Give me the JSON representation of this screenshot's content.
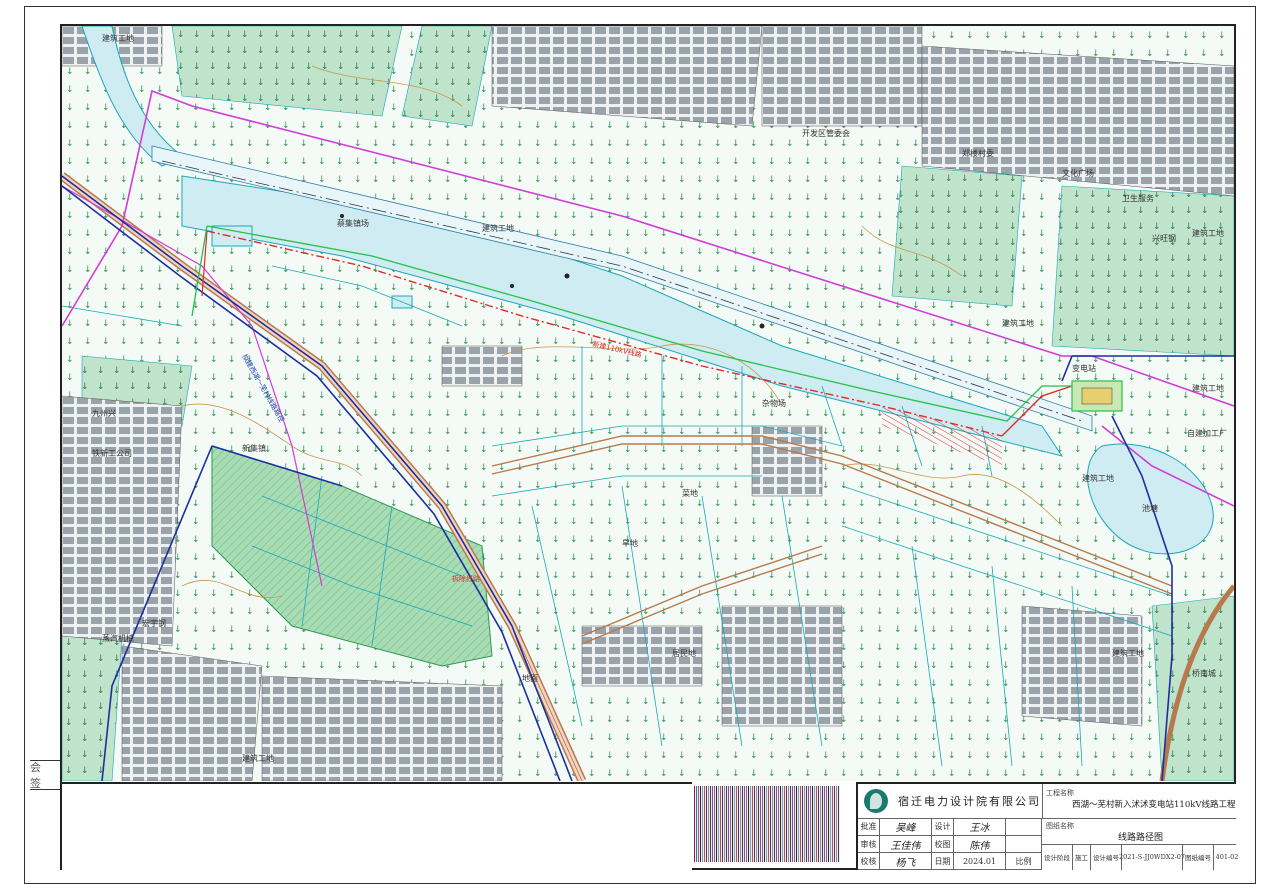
{
  "title_block": {
    "company": "宿迁电力设计院有限公司",
    "project_label": "工程名称",
    "project_name": "西湖～芜村新入沭沭变电站110kV线路工程",
    "drawing_label": "图纸名称",
    "drawing_name": "线路路径图",
    "roles": [
      "批准",
      "审核",
      "校核"
    ],
    "role_sigs": [
      "吴峰",
      "王佳伟",
      "杨飞"
    ],
    "roles_right": [
      "设计",
      "校图",
      "日期"
    ],
    "role_sigs_right": [
      "王冰",
      "陈伟",
      ""
    ],
    "date_value": "2024.01",
    "scale_label": "比例",
    "bottom_cells": [
      "设计阶段",
      "施工",
      "设计编号",
      "2021-S-JJ0WDX2-07",
      "图纸编号",
      "401-02"
    ]
  },
  "margin": {
    "sign_label": "会签"
  },
  "map": {
    "labels": [
      "蔡集镇场",
      "建筑工地",
      "建筑工地",
      "建筑工地",
      "建筑工地",
      "新集镇",
      "杂物场",
      "地面",
      "建筑工地",
      "宏宇钢",
      "铁新工公司",
      "九州兴",
      "桥南城",
      "建筑工地",
      "自建加工厂",
      "郑楼村委",
      "文化广场",
      "卫生服务",
      "建筑工地",
      "变电站",
      "居民地",
      "旱地",
      "池塘",
      "建筑工地",
      "菜地",
      "兴旺钢",
      "蒸汽机械",
      "开发区管委会"
    ],
    "route_notes": [
      "新建110kV线路",
      "拟建西湖～芜村线路路径",
      "拆除线路"
    ],
    "colors": {
      "vegetation": "#c9e8d3",
      "water": "#d3eef3",
      "building": "#b8bec4",
      "route_magenta": "#d13dd6",
      "route_blue": "#1b2f9e",
      "route_red": "#e02a2a",
      "route_green": "#27c04a",
      "road_brown": "#b77a4d",
      "contour": "#c8974a",
      "cyan_lines": "#1aa7b8"
    }
  }
}
